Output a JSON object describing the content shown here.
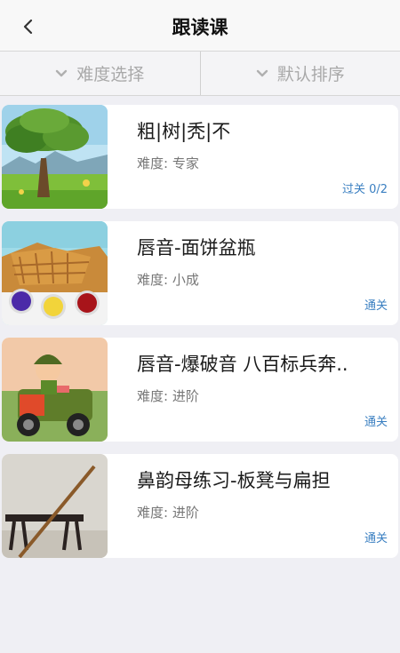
{
  "header": {
    "title": "跟读课",
    "back_icon": "chevron-left-icon"
  },
  "filters": [
    {
      "label": "难度选择",
      "icon": "chevron-down-icon"
    },
    {
      "label": "默认排序",
      "icon": "chevron-down-icon"
    }
  ],
  "lessons": [
    {
      "title": "粗|树|秃|不",
      "level": "难度: 专家",
      "status": "过关 0/2",
      "thumb": "tree-landscape"
    },
    {
      "title": "唇音-面饼盆瓶",
      "level": "难度: 小成",
      "status": "通关",
      "thumb": "waffles-paint"
    },
    {
      "title": "唇音-爆破音 八百标兵奔..",
      "level": "难度: 进阶",
      "status": "通关",
      "thumb": "soldier-jeep"
    },
    {
      "title": "鼻韵母练习-板凳与扁担",
      "level": "难度: 进阶",
      "status": "通关",
      "thumb": "bench-pole"
    }
  ],
  "colors": {
    "accent": "#3a7fc1",
    "background": "#efeff4"
  }
}
